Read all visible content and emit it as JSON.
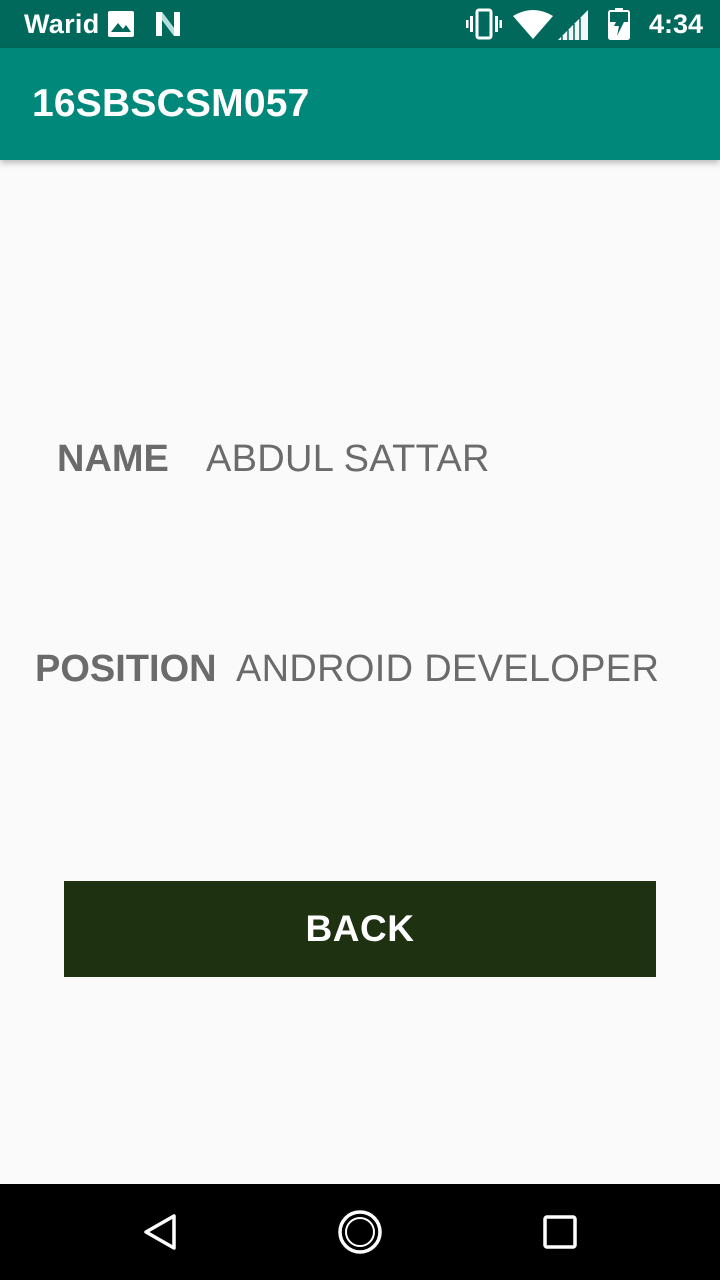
{
  "status_bar": {
    "carrier": "Warid",
    "time": "4:34",
    "icons": [
      "image-icon",
      "n-icon",
      "vibrate-icon",
      "wifi-icon",
      "signal-icon",
      "battery-icon"
    ]
  },
  "app_bar": {
    "title": "16SBSCSM057",
    "color": "#00897b",
    "status_color": "#00695c"
  },
  "profile": {
    "name_label": "NAME",
    "name_value": "ABDUL SATTAR",
    "position_label": "POSITION",
    "position_value": "ANDROID DEVELOPER"
  },
  "back_button": {
    "label": "BACK",
    "color": "#1e3212"
  },
  "nav_bar": {
    "icons": [
      "back-triangle-icon",
      "home-circle-icon",
      "recents-square-icon"
    ]
  }
}
